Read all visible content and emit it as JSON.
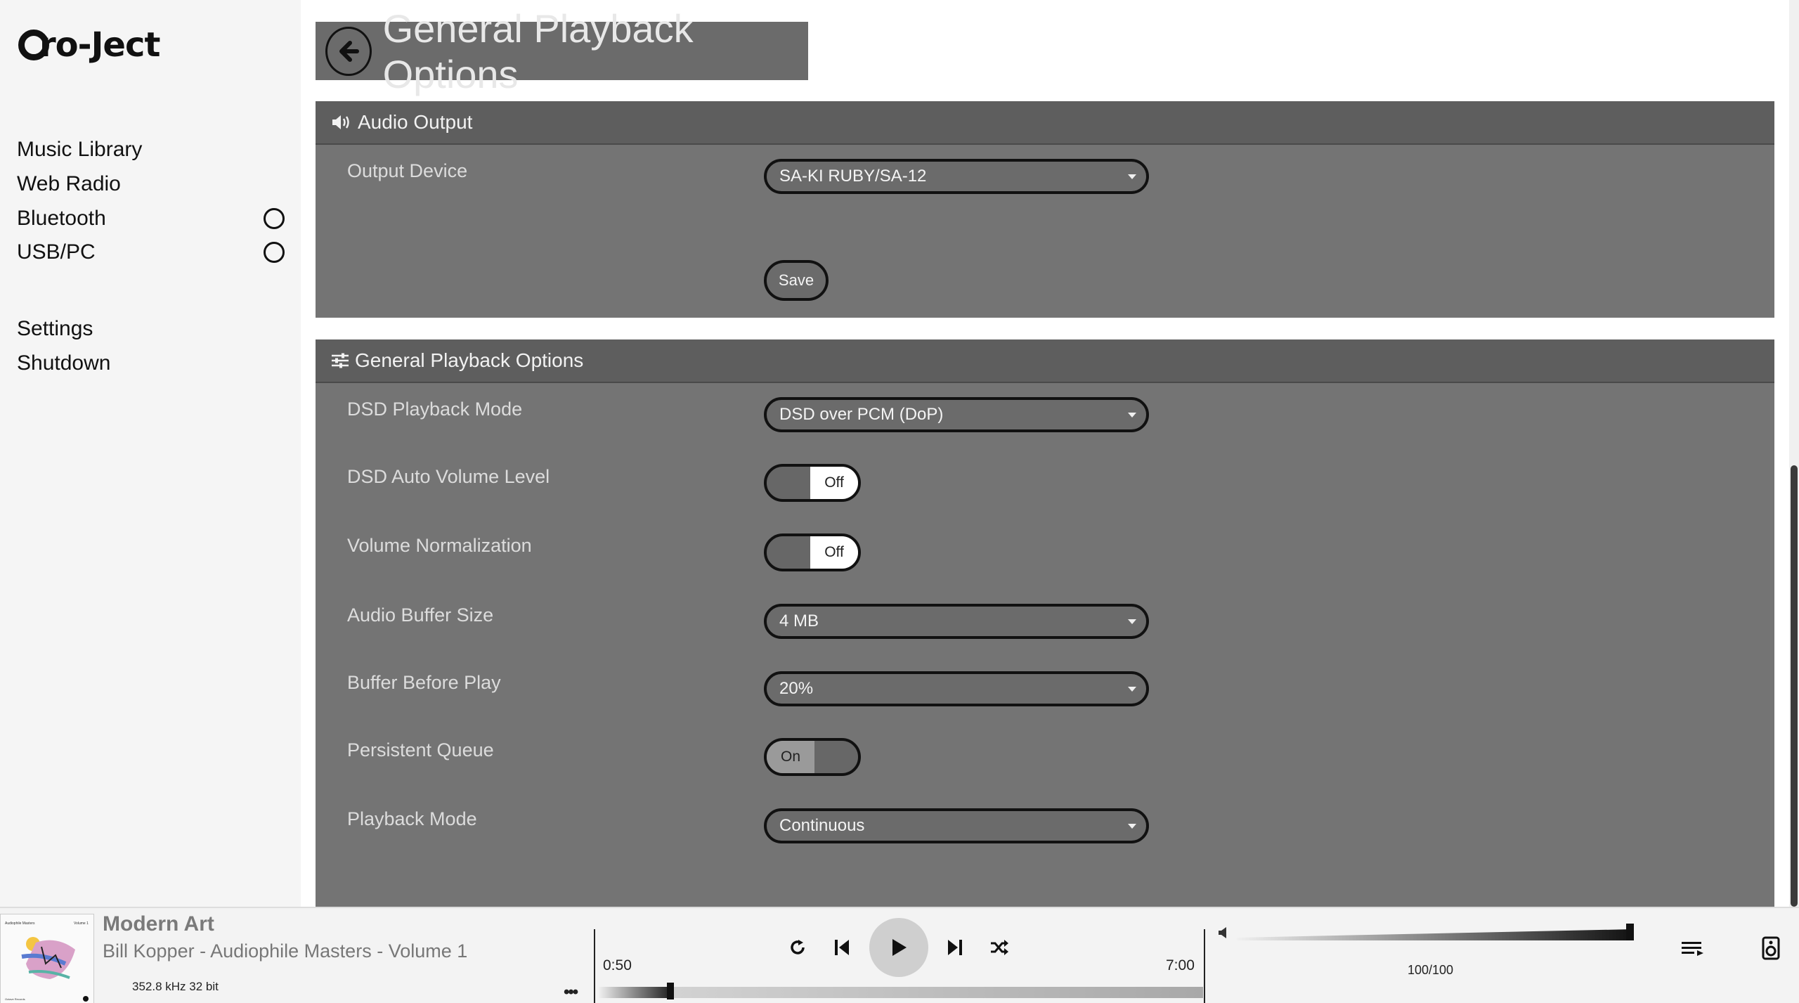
{
  "brand": {
    "logo_text": "ro-Ject"
  },
  "sidebar": {
    "items": [
      {
        "label": "Music Library"
      },
      {
        "label": "Web Radio"
      },
      {
        "label": "Bluetooth"
      },
      {
        "label": "USB/PC"
      },
      {
        "label": "Settings"
      },
      {
        "label": "Shutdown"
      }
    ]
  },
  "header": {
    "title": "General Playback Options"
  },
  "audio_output": {
    "heading": "Audio Output",
    "output_device_label": "Output Device",
    "output_device_value": "SA-KI RUBY/SA-12",
    "save_label": "Save"
  },
  "playback": {
    "heading": "General Playback Options",
    "dsd_mode_label": "DSD Playback Mode",
    "dsd_mode_value": "DSD over PCM (DoP)",
    "dsd_auto_volume_label": "DSD Auto Volume Level",
    "dsd_auto_volume_state": "Off",
    "volume_normalization_label": "Volume Normalization",
    "volume_normalization_state": "Off",
    "buffer_size_label": "Audio Buffer Size",
    "buffer_size_value": "4 MB",
    "buffer_before_play_label": "Buffer Before Play",
    "buffer_before_play_value": "20%",
    "persistent_queue_label": "Persistent Queue",
    "persistent_queue_state": "On",
    "playback_mode_label": "Playback Mode",
    "playback_mode_value": "Continuous"
  },
  "player": {
    "track_title": "Modern Art",
    "track_artist": "Bill Kopper - Audiophile Masters - Volume 1",
    "format": "352.8 kHz 32 bit",
    "elapsed": "0:50",
    "total": "7:00",
    "progress_fraction": 0.119,
    "volume_text": "100/100",
    "volume_fraction": 1.0,
    "cover_title": "Audiophile Masters",
    "cover_subtitle": "Volume 1",
    "cover_label": "Octave Records"
  },
  "colors": {
    "panel": "#747474",
    "panel_header": "#5e5e5e",
    "sidebar": "#f5f5f5",
    "player": "#f3f3f3"
  }
}
